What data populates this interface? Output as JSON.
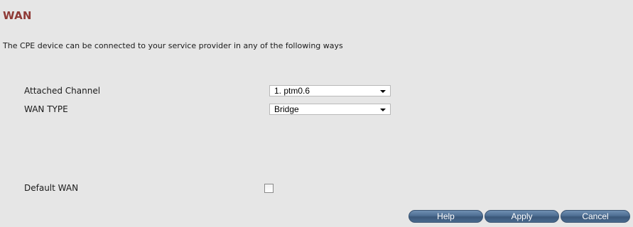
{
  "page": {
    "title": "WAN",
    "description": "The CPE device can be connected to your service provider in any of the following ways"
  },
  "form": {
    "attached_channel": {
      "label": "Attached Channel",
      "value": "1. ptm0.6"
    },
    "wan_type": {
      "label": "WAN TYPE",
      "value": "Bridge"
    },
    "default_wan": {
      "label": "Default WAN",
      "checked": false
    }
  },
  "buttons": {
    "help": "Help",
    "apply": "Apply",
    "cancel": "Cancel"
  },
  "colors": {
    "title": "#8f3a36",
    "background": "#e6e6e6",
    "button": "#4e6e93"
  }
}
